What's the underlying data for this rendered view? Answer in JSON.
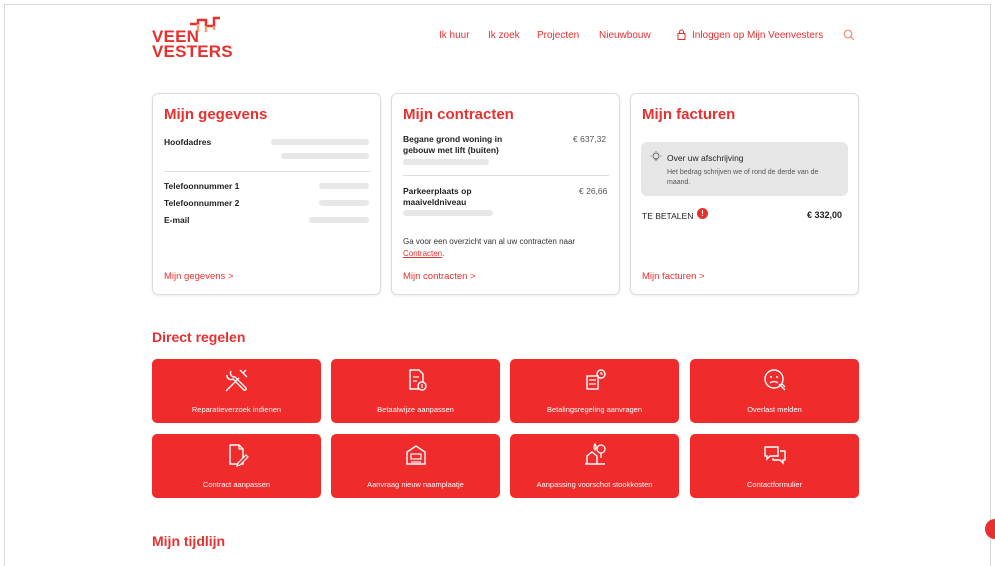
{
  "brand": {
    "line1": "VEEN",
    "line2": "VESTERS",
    "accent": "#e8302f"
  },
  "nav": {
    "items": [
      "Ik huur",
      "Ik zoek",
      "Projecten",
      "Nieuwbouw"
    ],
    "login": "Inloggen op Mijn Veenvesters",
    "login_icon": "lock-icon",
    "search_icon": "search-icon"
  },
  "gegevens": {
    "title": "Mijn gegevens",
    "hoofdadres": "Hoofdadres",
    "tel1": "Telefoonnummer 1",
    "tel2": "Telefoonnummer 2",
    "email": "E-mail",
    "link": "Mijn gegevens >"
  },
  "contracten": {
    "title": "Mijn contracten",
    "item1_name": "Begane grond woning in gebouw met lift (buiten)",
    "item1_price": "€ 637,32",
    "item2_name": "Parkeerplaats op maaiveldniveau",
    "item2_price": "€ 26,66",
    "note": "Ga voor een overzicht van al uw contracten naar",
    "note_link": "Contracten",
    "link": "Mijn contracten >"
  },
  "facturen": {
    "title": "Mijn facturen",
    "info_title": "Over uw afschrijving",
    "info_text": "Het bedrag schrijven we of rond de derde van de maand.",
    "to_pay_label": "TE BETALEN",
    "to_pay_amount": "€ 332,00",
    "link": "Mijn facturen >"
  },
  "direct": {
    "title": "Direct regelen",
    "tiles": [
      {
        "label": "Reparatieverzoek indienen",
        "icon": "tools-icon"
      },
      {
        "label": "Betaalwijze aanpassen",
        "icon": "document-payment-icon"
      },
      {
        "label": "Betalingsregeling aanvragen",
        "icon": "payment-arrangement-icon"
      },
      {
        "label": "Overlast melden",
        "icon": "nuisance-face-icon"
      },
      {
        "label": "Contract aanpassen",
        "icon": "contract-edit-icon"
      },
      {
        "label": "Aanvraag nieuw naamplaatje",
        "icon": "nameplate-icon"
      },
      {
        "label": "Aanpassing voorschot stookkosten",
        "icon": "heating-cost-icon"
      },
      {
        "label": "Contactformulier",
        "icon": "chat-bubbles-icon"
      }
    ]
  },
  "tijdlijn": {
    "title": "Mijn tijdlijn"
  }
}
